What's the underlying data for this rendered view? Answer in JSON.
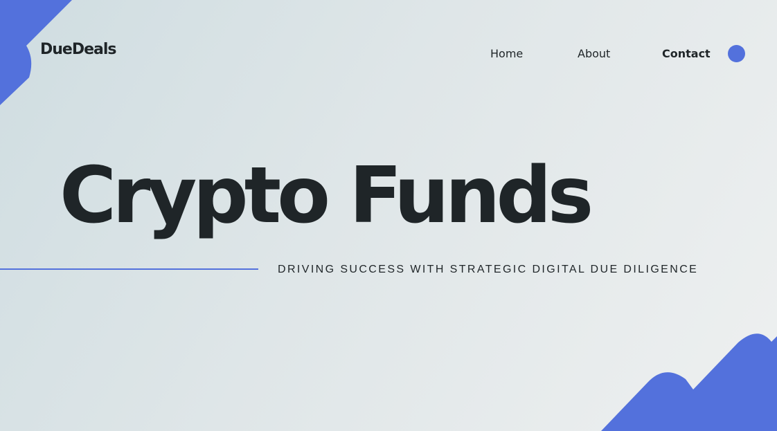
{
  "brand": {
    "name": "DueDeals"
  },
  "nav": {
    "home": "Home",
    "about": "About",
    "contact": "Contact"
  },
  "hero": {
    "title": "Crypto Funds",
    "subtitle": "DRIVING SUCCESS WITH STRATEGIC DIGITAL DUE DILIGENCE"
  },
  "colors": {
    "accent": "#5371dc",
    "text": "#1f2528",
    "bg_start": "#cfdde1",
    "bg_end": "#eef0f0"
  },
  "icons": {
    "nav_dot": "circle-icon"
  }
}
